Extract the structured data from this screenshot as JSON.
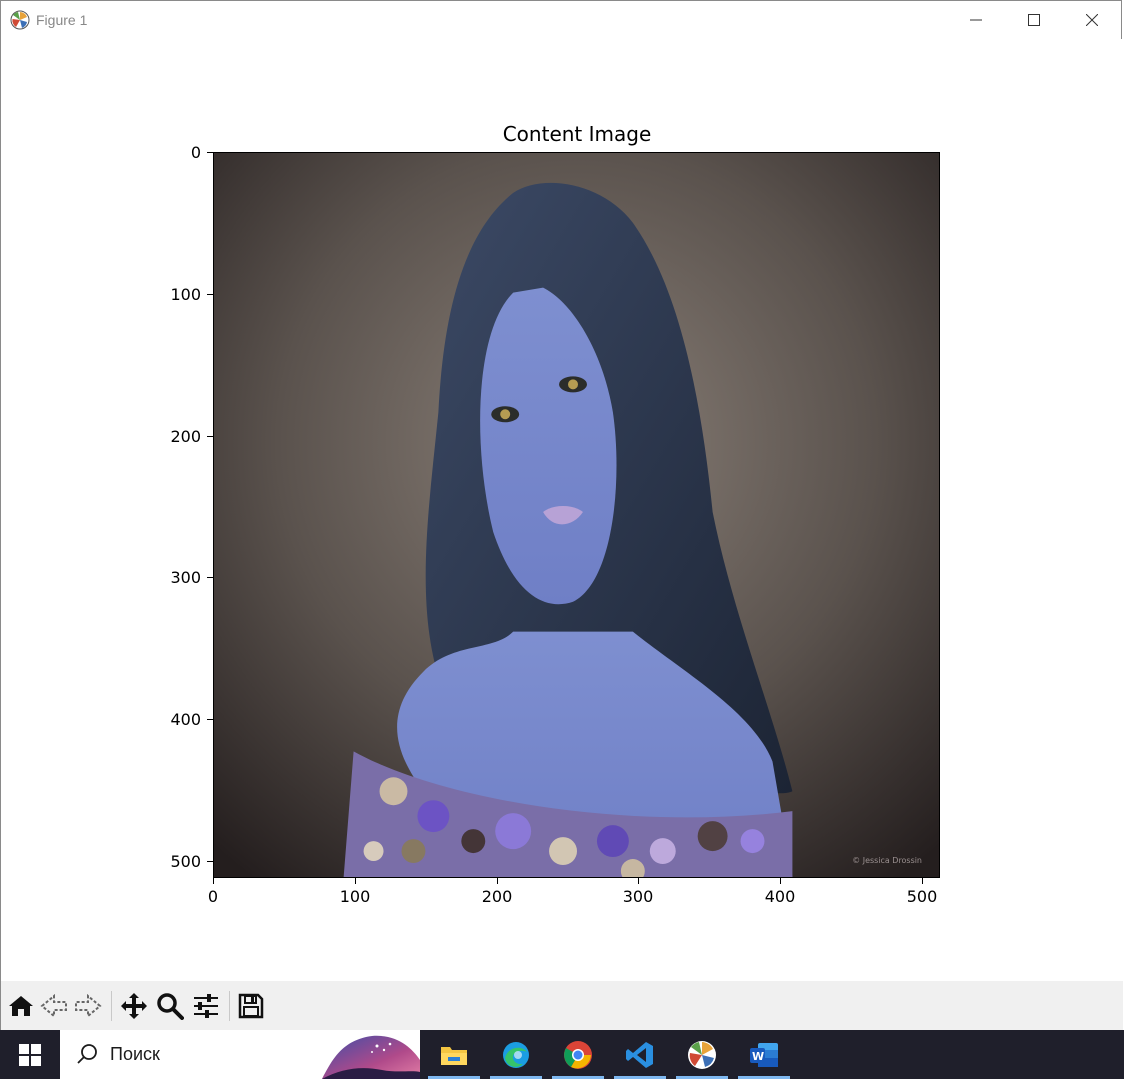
{
  "window": {
    "title": "Figure 1",
    "controls": [
      "minimize-icon",
      "maximize-icon",
      "close-icon"
    ]
  },
  "figure": {
    "title": "Content Image",
    "image_description_icon": "portrait-photo",
    "y_ticks": [
      "0",
      "100",
      "200",
      "300",
      "400",
      "500"
    ],
    "x_ticks": [
      "0",
      "100",
      "200",
      "300",
      "400",
      "500"
    ],
    "watermark": "© Jessica Drossin"
  },
  "toolbar": {
    "buttons": [
      "home-icon",
      "back-icon",
      "forward-icon",
      "pan-icon",
      "zoom-icon",
      "configure-icon",
      "save-icon"
    ]
  },
  "taskbar": {
    "search_placeholder": "Поиск",
    "apps": [
      "file-explorer-icon",
      "edge-icon",
      "chrome-icon",
      "vscode-icon",
      "python-icon",
      "word-icon"
    ]
  },
  "colors": {
    "toolbar_bg": "#f0f0f0",
    "taskbar_bg": "#1f1f2b",
    "active_underline": "#7fb8f0"
  }
}
